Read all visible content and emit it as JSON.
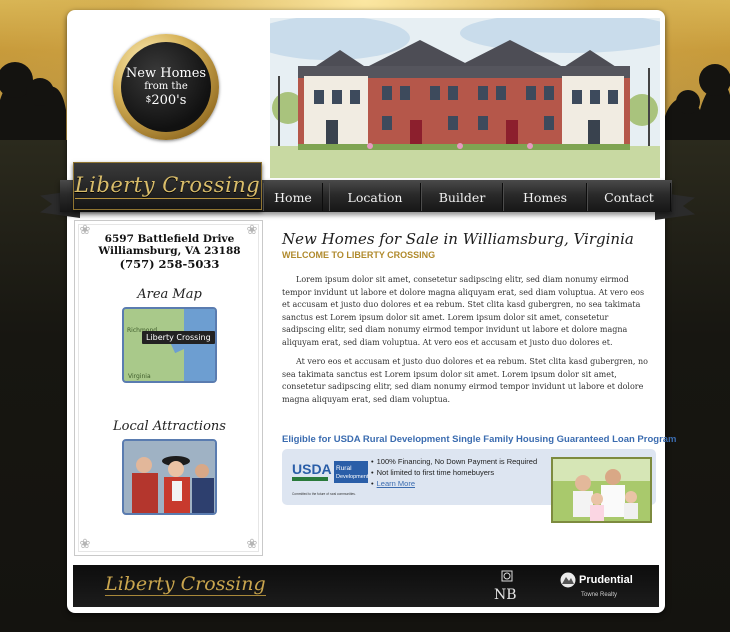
{
  "badge": {
    "line1": "New Homes",
    "line2": "from the",
    "price_prefix": "$",
    "price": "200's"
  },
  "brand": {
    "logo_text": "Liberty Crossing"
  },
  "nav": {
    "items": [
      "Home",
      "Location",
      "Builder",
      "Homes",
      "Contact"
    ]
  },
  "sidebar": {
    "address_line1": "6597 Battlefield Drive",
    "address_line2": "Williamsburg, VA 23188",
    "phone": "(757) 258-5033",
    "map_heading": "Area Map",
    "map_label": "Liberty Crossing",
    "map_state": "Virginia",
    "map_city": "Richmond",
    "attractions_heading": "Local Attractions"
  },
  "main": {
    "title": "New Homes for Sale in Williamsburg, Virginia",
    "subtitle": "WELCOME TO LIBERTY CROSSING",
    "paragraph1": "Lorem ipsum dolor sit amet, consetetur sadipscing elitr, sed diam nonumy eirmod tempor invidunt ut labore et dolore magna aliquyam erat, sed diam voluptua. At vero eos et accusam et justo duo dolores et ea rebum. Stet clita kasd gubergren, no sea takimata sanctus est Lorem ipsum dolor sit amet. Lorem ipsum dolor sit amet, consetetur sadipscing elitr, sed diam nonumy eirmod tempor invidunt ut labore et dolore magna aliquyam erat, sed diam voluptua. At vero eos et accusam et justo duo dolores et.",
    "paragraph2": "At vero eos et accusam et justo duo dolores et ea rebum. Stet clita kasd gubergren, no sea takimata sanctus est Lorem ipsum dolor sit amet. Lorem ipsum dolor sit amet, consetetur sadipscing elitr, sed diam nonumy eirmod tempor invidunt ut labore et dolore magna aliquyam erat, sed diam voluptua."
  },
  "usda": {
    "heading": "Eligible for USDA Rural Development Single Family Housing Guaranteed Loan Program",
    "logo_usda": "USDA",
    "logo_rural": "Rural",
    "logo_development": "Development",
    "logo_tagline": "Committed to the future of rural communities.",
    "bullet1": "100% Financing, No Down Payment is Required",
    "bullet2": "Not limited to first time homebuyers",
    "link": "Learn More"
  },
  "footer": {
    "logo_text": "Liberty Crossing",
    "builder_mark": "NB",
    "brand": "Prudential",
    "brand_sub": "Towne Realty"
  },
  "colors": {
    "accent_gold": "#b08a2c",
    "link_blue": "#3b6cb0",
    "nav_dark": "#222222"
  }
}
